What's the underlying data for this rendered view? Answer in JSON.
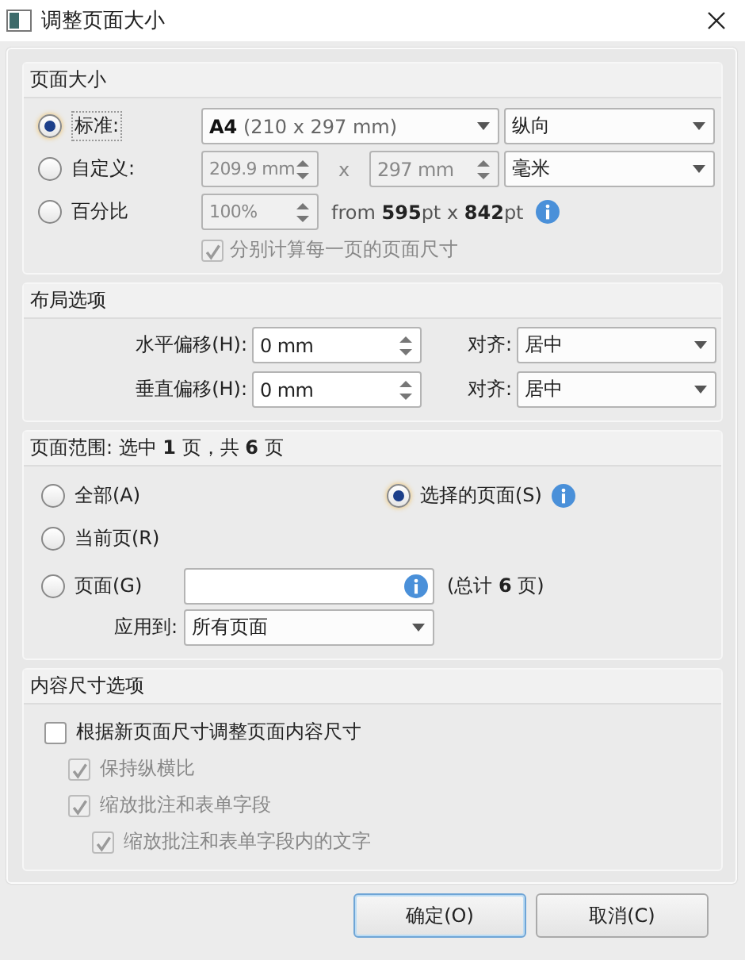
{
  "window": {
    "title": "调整页面大小"
  },
  "page_size": {
    "title": "页面大小",
    "options": [
      {
        "label": "标准:",
        "selected": true
      },
      {
        "label": "自定义:",
        "selected": false
      },
      {
        "label": "百分比",
        "selected": false
      }
    ],
    "standard": {
      "size": "**A4** (210 x 297 mm)",
      "orientation": "纵向"
    },
    "custom": {
      "width": "209.9 mm",
      "times": "x",
      "height": "297 mm",
      "unit": "毫米",
      "disabled": true
    },
    "percent": {
      "value": "100%",
      "from": "from **595**pt x **842**pt",
      "disabled": true
    },
    "separate": {
      "label": "分别计算每一页的页面尺寸",
      "checked": true,
      "disabled": true
    }
  },
  "layout": {
    "title": "布局选项",
    "rows": [
      {
        "label": "水平偏移(H):",
        "value": "0 mm",
        "align_label": "对齐:",
        "align": "居中"
      },
      {
        "label": "垂直偏移(H):",
        "value": "0 mm",
        "align_label": "对齐:",
        "align": "居中"
      }
    ]
  },
  "page_range": {
    "title": "页面范围: 选中 **1** 页，共 **6** 页",
    "options": [
      {
        "label": "全部(A)",
        "selected": false
      },
      {
        "label": "选择的页面(S)",
        "selected": true
      },
      {
        "label": "当前页(R)",
        "selected": false
      },
      {
        "label": "页面(G)",
        "selected": false
      }
    ],
    "total": "(总计 **6** 页)",
    "apply_label": "应用到:",
    "apply": "所有页面"
  },
  "content": {
    "title": "内容尺寸选项",
    "items": [
      {
        "label": "根据新页面尺寸调整页面内容尺寸",
        "checked": false,
        "disabled": false,
        "children": [
          {
            "label": "保持纵横比",
            "checked": true,
            "disabled": true
          },
          {
            "label": "缩放批注和表单字段",
            "checked": true,
            "disabled": true,
            "children": [
              {
                "label": "缩放批注和表单字段内的文字",
                "checked": true,
                "disabled": true
              }
            ]
          }
        ]
      }
    ]
  },
  "buttons": [
    {
      "label": "确定(O)",
      "default": true
    },
    {
      "label": "取消(C)",
      "default": false
    }
  ]
}
